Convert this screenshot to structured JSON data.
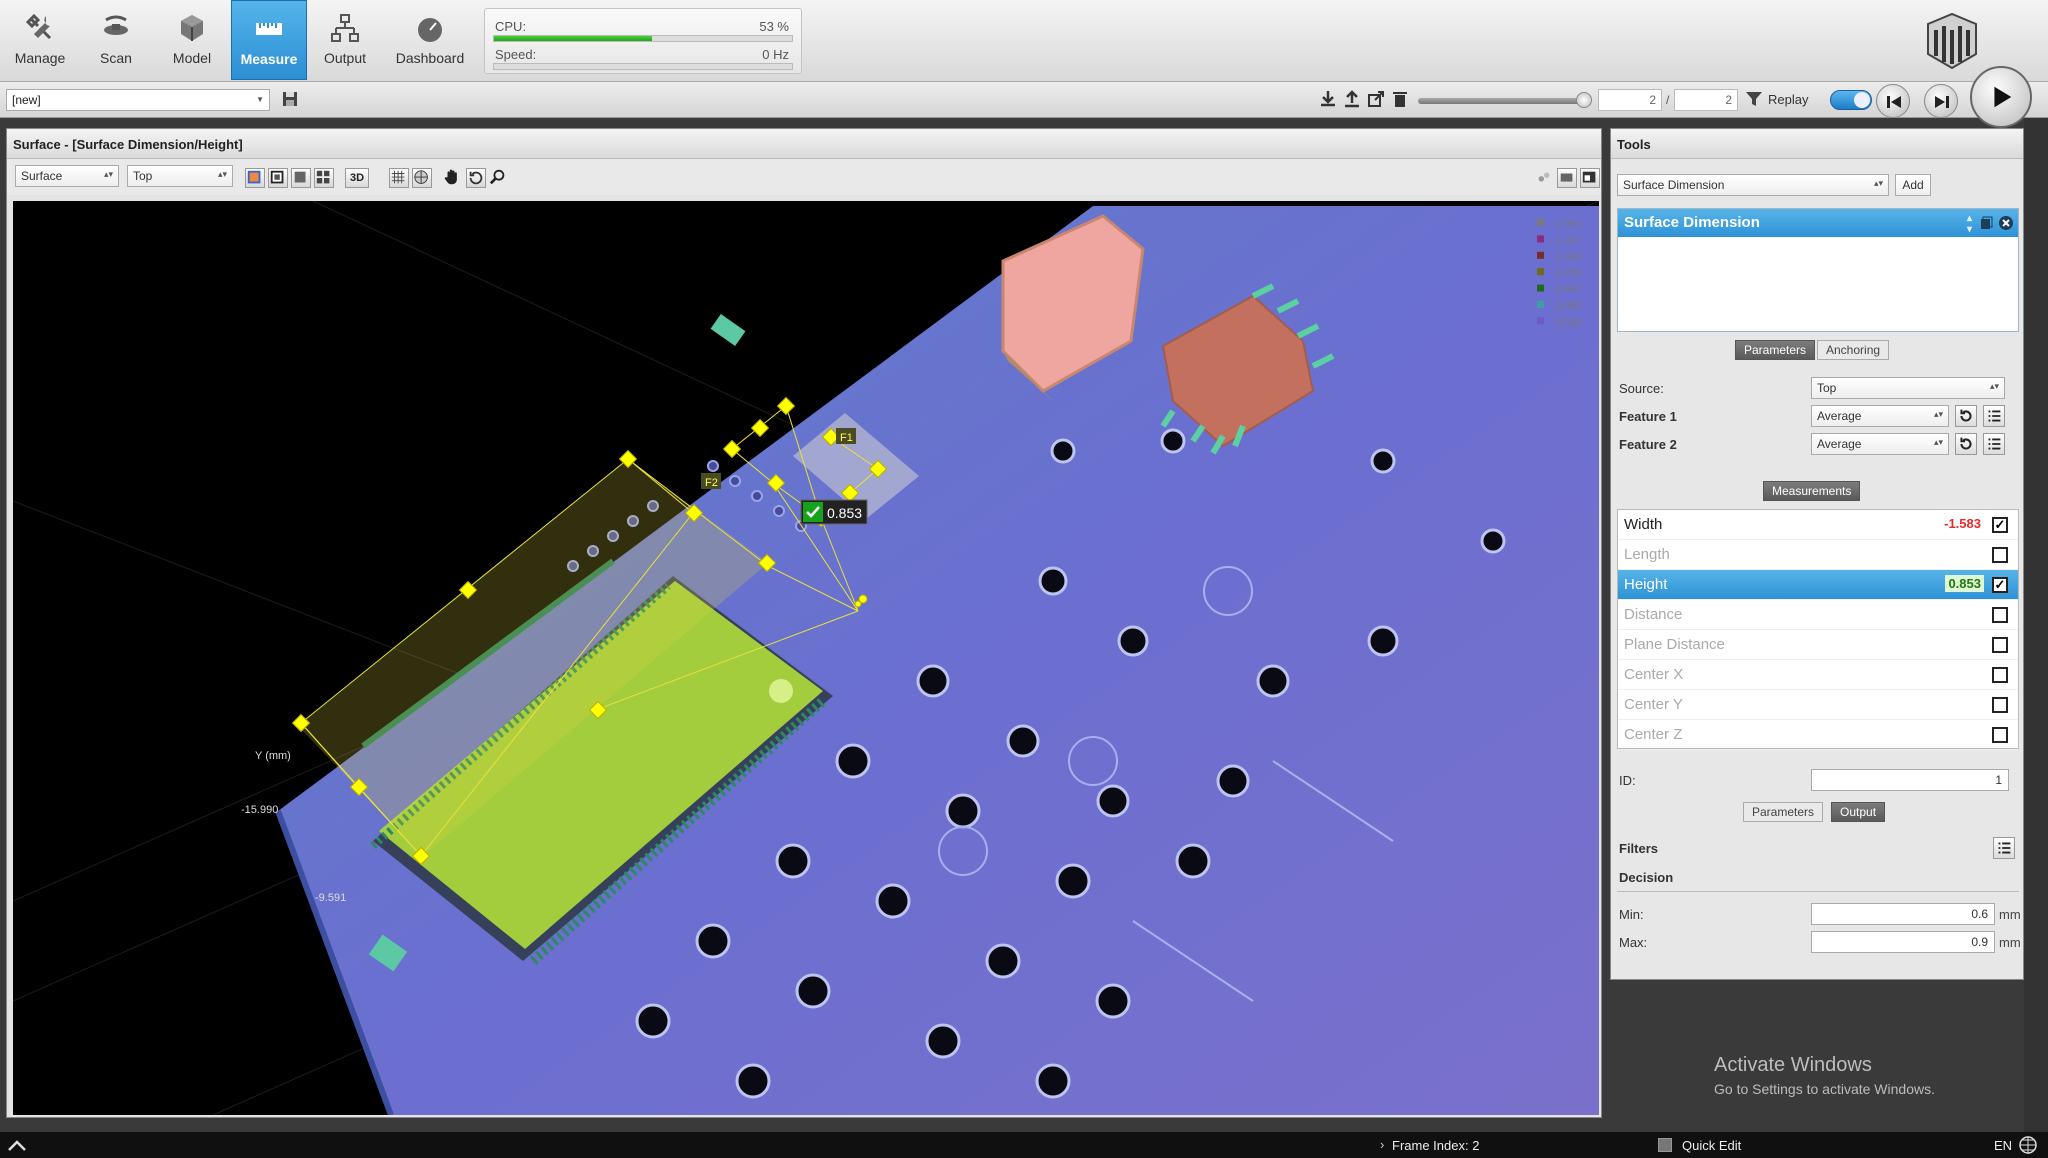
{
  "nav": {
    "manage": "Manage",
    "scan": "Scan",
    "model": "Model",
    "measure": "Measure",
    "output": "Output",
    "dashboard": "Dashboard"
  },
  "perf": {
    "cpu_label": "CPU:",
    "cpu_value": "53 %",
    "cpu_fraction": 0.53,
    "speed_label": "Speed:",
    "speed_value": "0 Hz",
    "speed_fraction": 0
  },
  "toolbar": {
    "job_value": "[new]",
    "frame_current": "2",
    "frame_separator": "/",
    "frame_total": "2",
    "replay_label": "Replay"
  },
  "surface": {
    "title": "Surface - [Surface Dimension/Height]",
    "source_value": "Surface",
    "view_value": "Top",
    "mode_3d": "3D",
    "legend": [
      "-1.000",
      "-1.417",
      "-1.833",
      "-2.250",
      "-2.667",
      "-3.083",
      "-3.500"
    ],
    "legend_colors": [
      "#7a7a7a",
      "#8c2a80",
      "#7a2c2c",
      "#6d6a1a",
      "#1f6a1f",
      "#3aa0a0",
      "#6a5cc4"
    ],
    "feature1_label": "F1",
    "feature2_label": "F2",
    "result_value": "0.853",
    "axis_label": "Y (mm)",
    "axis_tick1": "-15.990",
    "axis_tick2": "-9.591"
  },
  "tools": {
    "title": "Tools",
    "tool_select": "Surface Dimension",
    "add_label": "Add",
    "card_title": "Surface Dimension",
    "tab_parameters": "Parameters",
    "tab_anchoring": "Anchoring",
    "source_label": "Source:",
    "source_value": "Top",
    "feature1_label": "Feature 1",
    "feature1_value": "Average",
    "feature2_label": "Feature 2",
    "feature2_value": "Average",
    "measurements_label": "Measurements",
    "measurements": [
      {
        "name": "Width",
        "value": "-1.583",
        "checked": true,
        "enabled": true,
        "selected": false,
        "status": "fail"
      },
      {
        "name": "Length",
        "value": "",
        "checked": false,
        "enabled": false,
        "selected": false,
        "status": ""
      },
      {
        "name": "Height",
        "value": "0.853",
        "checked": true,
        "enabled": true,
        "selected": true,
        "status": "pass"
      },
      {
        "name": "Distance",
        "value": "",
        "checked": false,
        "enabled": false,
        "selected": false,
        "status": ""
      },
      {
        "name": "Plane Distance",
        "value": "",
        "checked": false,
        "enabled": false,
        "selected": false,
        "status": ""
      },
      {
        "name": "Center X",
        "value": "",
        "checked": false,
        "enabled": false,
        "selected": false,
        "status": ""
      },
      {
        "name": "Center Y",
        "value": "",
        "checked": false,
        "enabled": false,
        "selected": false,
        "status": ""
      },
      {
        "name": "Center Z",
        "value": "",
        "checked": false,
        "enabled": false,
        "selected": false,
        "status": ""
      }
    ],
    "id_label": "ID:",
    "id_value": "1",
    "tab2_parameters": "Parameters",
    "tab2_output": "Output",
    "filters_label": "Filters",
    "decision_label": "Decision",
    "min_label": "Min:",
    "min_value": "0.6",
    "max_label": "Max:",
    "max_value": "0.9",
    "unit": "mm"
  },
  "status": {
    "frame_index": "Frame Index: 2",
    "quick_edit": "Quick Edit",
    "lang": "EN"
  },
  "watermark": {
    "line1": "Activate Windows",
    "line2": "Go to Settings to activate Windows."
  }
}
